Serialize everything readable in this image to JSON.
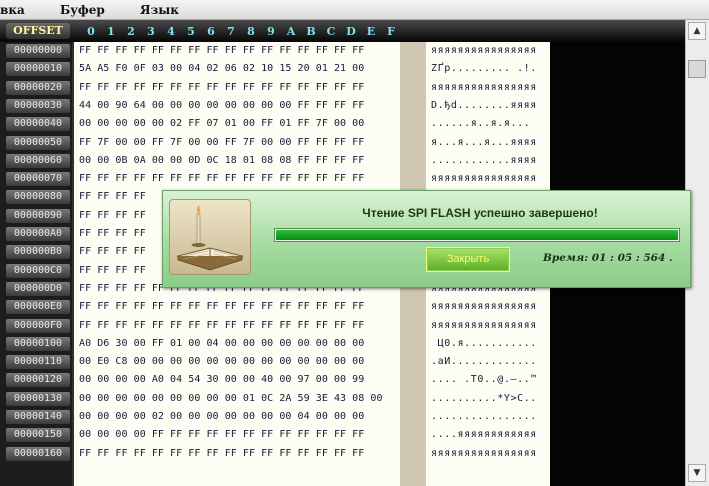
{
  "menu": [
    "вка",
    "Буфер",
    "Язык"
  ],
  "header": {
    "offset_label": "OFFSET",
    "hex_columns": [
      "0",
      "1",
      "2",
      "3",
      "4",
      "5",
      "6",
      "7",
      "8",
      "9",
      "A",
      "B",
      "C",
      "D",
      "E",
      "F"
    ]
  },
  "rows": [
    {
      "offset": "00000000",
      "hex": "FF FF FF FF FF FF FF FF FF FF FF FF FF FF FF FF",
      "ascii": "яяяяяяяяяяяяяяяя"
    },
    {
      "offset": "00000010",
      "hex": "5A A5 F0 0F 03 00 04 02 06 02 10 15 20 01 21 00",
      "ascii": "ZҐр......... .!."
    },
    {
      "offset": "00000020",
      "hex": "FF FF FF FF FF FF FF FF FF FF FF FF FF FF FF FF",
      "ascii": "яяяяяяяяяяяяяяяя"
    },
    {
      "offset": "00000030",
      "hex": "44 00 90 64 00 00 00 00 00 00 00 00 FF FF FF FF",
      "ascii": "D.ђd........яяяя"
    },
    {
      "offset": "00000040",
      "hex": "00 00 00 00 00 02 FF 07 01 00 FF 01 FF 7F 00 00",
      "ascii": "......я..я.я..."
    },
    {
      "offset": "00000050",
      "hex": "FF 7F 00 00 FF 7F 00 00 FF 7F 00 00 FF FF FF FF",
      "ascii": "я...я...я...яяяя"
    },
    {
      "offset": "00000060",
      "hex": "00 00 0B 0A 00 00 0D 0C 18 01 08 08 FF FF FF FF",
      "ascii": "............яяяя"
    },
    {
      "offset": "00000070",
      "hex": "FF FF FF FF FF FF FF FF FF FF FF FF FF FF FF FF",
      "ascii": "яяяяяяяяяяяяяяяя"
    },
    {
      "offset": "00000080",
      "hex": "FF FF FF FF",
      "ascii": ""
    },
    {
      "offset": "00000090",
      "hex": "FF FF FF FF",
      "ascii": ""
    },
    {
      "offset": "000000A0",
      "hex": "FF FF FF FF",
      "ascii": ""
    },
    {
      "offset": "000000B0",
      "hex": "FF FF FF FF",
      "ascii": ""
    },
    {
      "offset": "000000C0",
      "hex": "FF FF FF FF",
      "ascii": ""
    },
    {
      "offset": "000000D0",
      "hex": "FF FF FF FF FF FF FF FF FF FF FF FF FF FF FF FF",
      "ascii": "яяяяяяяяяяяяяяяя"
    },
    {
      "offset": "000000E0",
      "hex": "FF FF FF FF FF FF FF FF FF FF FF FF FF FF FF FF",
      "ascii": "яяяяяяяяяяяяяяяя"
    },
    {
      "offset": "000000F0",
      "hex": "FF FF FF FF FF FF FF FF FF FF FF FF FF FF FF FF",
      "ascii": "яяяяяяяяяяяяяяяя"
    },
    {
      "offset": "00000100",
      "hex": "A0 D6 30 00 FF 01 00 04 00 00 00 00 00 00 00 00",
      "ascii": " Ц0.я..........."
    },
    {
      "offset": "00000110",
      "hex": "00 E0 C8 00 00 00 00 00 00 00 00 00 00 00 00 00",
      "ascii": ".аИ............."
    },
    {
      "offset": "00000120",
      "hex": "00 00 00 00 A0 04 54 30 00 00 40 00 97 00 00 99",
      "ascii": ".... .T0..@.—..™"
    },
    {
      "offset": "00000130",
      "hex": "00 00 00 00 00 00 00 00 00 01 0C 2A 59 3E 43 08 00",
      "ascii": "..........*Y>C.."
    },
    {
      "offset": "00000140",
      "hex": "00 00 00 00 02 00 00 00 00 00 00 00 04 00 00 00",
      "ascii": "................"
    },
    {
      "offset": "00000150",
      "hex": "00 00 00 00 FF FF FF FF FF FF FF FF FF FF FF FF",
      "ascii": "....яяяяяяяяяяяя"
    },
    {
      "offset": "00000160",
      "hex": "FF FF FF FF FF FF FF FF FF FF FF FF FF FF FF FF",
      "ascii": "яяяяяяяяяяяяяяяя"
    }
  ],
  "dialog": {
    "title": "Чтение SPI FLASH успешно завершено!",
    "progress": 1.0,
    "close_label": "Закрыть",
    "time_label": "Время:  01 : 05 : 564 ."
  }
}
